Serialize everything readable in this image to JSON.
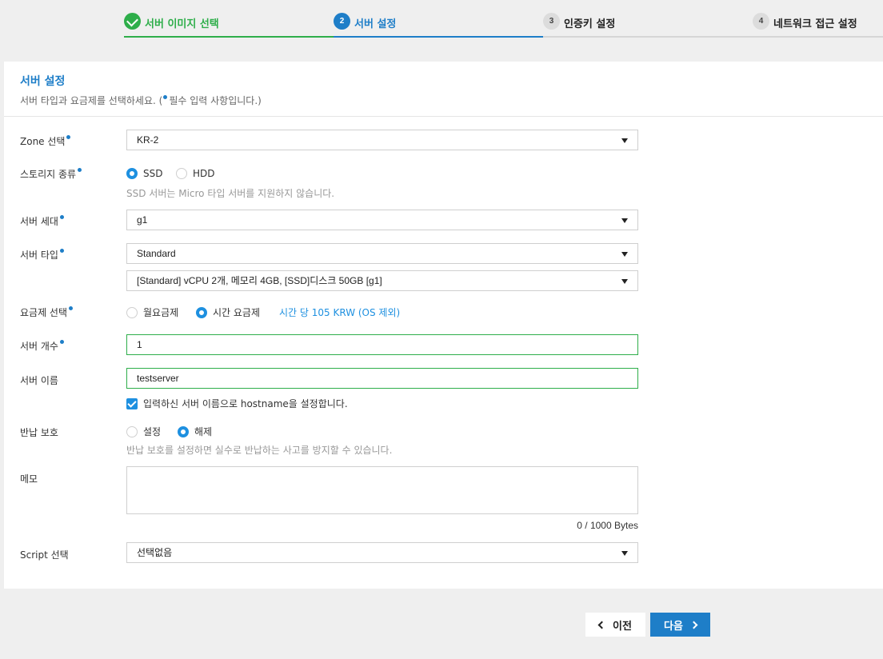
{
  "stepper": {
    "steps": [
      {
        "num": "",
        "label": "서버 이미지 선택",
        "state": "done"
      },
      {
        "num": "2",
        "label": "서버 설정",
        "state": "active"
      },
      {
        "num": "3",
        "label": "인증키 설정",
        "state": "todo"
      },
      {
        "num": "4",
        "label": "네트워크 접근 설정",
        "state": "todo"
      }
    ]
  },
  "panel": {
    "title": "서버 설정",
    "desc_prefix": "서버 타입과 요금제를 선택하세요. (",
    "desc_suffix": "필수 입력 사항입니다.)"
  },
  "form": {
    "zone": {
      "label": "Zone 선택",
      "value": "KR-2"
    },
    "storage": {
      "label": "스토리지 종류",
      "options": [
        "SSD",
        "HDD"
      ],
      "selected": "SSD",
      "hint": "SSD 서버는 Micro 타입 서버를 지원하지 않습니다."
    },
    "generation": {
      "label": "서버 세대",
      "value": "g1"
    },
    "server_type": {
      "label": "서버 타입",
      "value": "Standard",
      "spec_value": "[Standard] vCPU 2개, 메모리 4GB, [SSD]디스크 50GB [g1]"
    },
    "billing": {
      "label": "요금제 선택",
      "options": [
        "월요금제",
        "시간 요금제"
      ],
      "selected": "시간 요금제",
      "price_text": "시간 당 105 KRW (OS 제외)"
    },
    "count": {
      "label": "서버 개수",
      "value": "1"
    },
    "name": {
      "label": "서버 이름",
      "value": "testserver",
      "checkbox_label": "입력하신 서버 이름으로 hostname을 설정합니다.",
      "checkbox_checked": true
    },
    "return_protect": {
      "label": "반납 보호",
      "options": [
        "설정",
        "해제"
      ],
      "selected": "해제",
      "hint": "반납 보호를 설정하면 실수로 반납하는 사고를 방지할 수 있습니다."
    },
    "memo": {
      "label": "메모",
      "value": "",
      "counter": "0 / 1000 Bytes"
    },
    "script": {
      "label": "Script 선택",
      "value": "선택없음"
    }
  },
  "buttons": {
    "prev": "이전",
    "next": "다음"
  },
  "colors": {
    "primary": "#1e7ec8",
    "success": "#2eae4a",
    "radio": "#1e90e0"
  }
}
